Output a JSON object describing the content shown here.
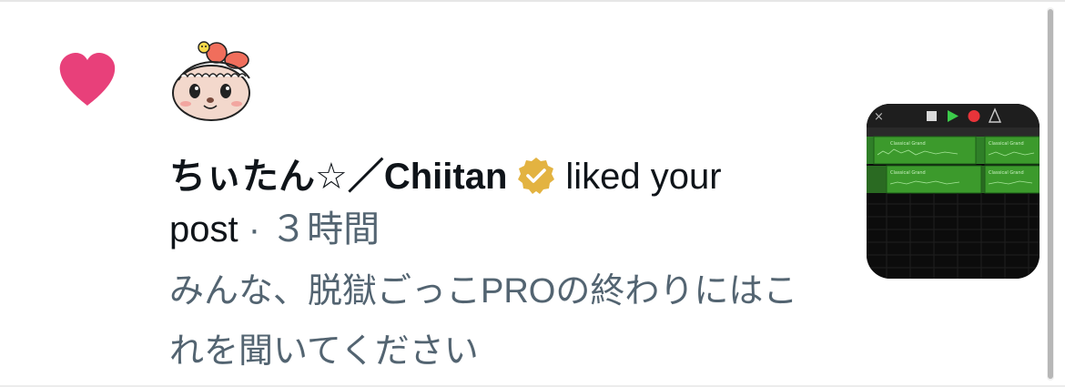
{
  "notification": {
    "type_icon": "heart-icon",
    "user": {
      "display_name": "ちぃたん☆／Chiitan",
      "verified": true,
      "avatar_icon": "otter-mascot-avatar"
    },
    "action_text": "liked your",
    "action_text_2": "post",
    "separator": "·",
    "time_ago": "３時間",
    "post_preview": "みんな、脱獄ごっこPROの終わりにはこれを聞いてください",
    "thumbnail_labels": [
      "Classical Grand",
      "Classical Grand",
      "Classical Grand",
      "Classical Grand"
    ]
  },
  "colors": {
    "heart": "#e8407a",
    "verified_badge": "#e3b341",
    "secondary_text": "#536471",
    "primary_text": "#0f1419",
    "track_green": "#3c9a2c"
  }
}
